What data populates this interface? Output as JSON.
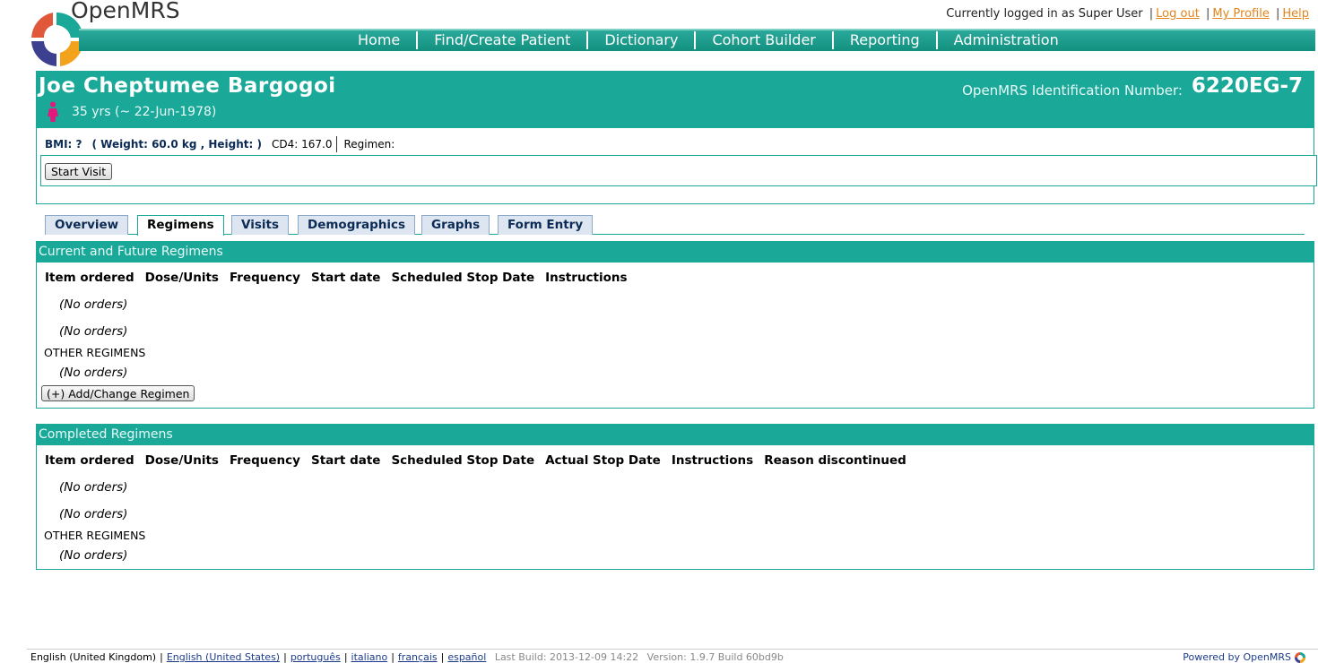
{
  "brand": {
    "name": "OpenMRS"
  },
  "user_bar": {
    "logged_in_text": "Currently logged in as Super User",
    "logout": "Log out",
    "my_profile": "My Profile",
    "help": "Help"
  },
  "nav": {
    "items": [
      "Home",
      "Find/Create Patient",
      "Dictionary",
      "Cohort Builder",
      "Reporting",
      "Administration"
    ]
  },
  "patient": {
    "name": "Joe Cheptumee Bargogoi",
    "age": "35 yrs (~ 22-Jun-1978)",
    "gender_icon": "female-icon",
    "id_label": "OpenMRS Identification Number:",
    "id_value": "6220EG-7",
    "bmi": "BMI: ?",
    "weight_height": "( Weight: 60.0 kg , Height: )",
    "cd4_label": "CD4:",
    "cd4_value": "167.0",
    "regimen_label": "Regimen:",
    "start_visit": "Start Visit"
  },
  "tabs": {
    "active": "Regimens",
    "items": [
      "Overview",
      "Regimens",
      "Visits",
      "Demographics",
      "Graphs",
      "Form Entry"
    ]
  },
  "current_regimens": {
    "title": "Current and Future Regimens",
    "headers": [
      "Item ordered",
      "Dose/Units",
      "Frequency",
      "Start date",
      "Scheduled Stop Date",
      "Instructions"
    ],
    "no_orders_1": "(No orders)",
    "no_orders_2": "(No orders)",
    "other_regimens": "OTHER REGIMENS",
    "no_orders_3": "(No orders)",
    "add_button": "(+) Add/Change Regimen"
  },
  "completed_regimens": {
    "title": "Completed Regimens",
    "headers": [
      "Item ordered",
      "Dose/Units",
      "Frequency",
      "Start date",
      "Scheduled Stop Date",
      "Actual Stop Date",
      "Instructions",
      "Reason discontinued"
    ],
    "no_orders_1": "(No orders)",
    "no_orders_2": "(No orders)",
    "other_regimens": "OTHER REGIMENS",
    "no_orders_3": "(No orders)"
  },
  "footer": {
    "current_locale": "English (United Kingdom)",
    "locales": [
      "English (United States)",
      "português",
      "italiano",
      "français",
      "español"
    ],
    "last_build": "Last Build: 2013-12-09 14:22",
    "version": "Version: 1.9.7 Build 60bd9b",
    "powered_by": "Powered by OpenMRS"
  },
  "colors": {
    "teal": "#1aa899",
    "link_orange": "#e3851c",
    "tab_blue": "#0b2a55"
  }
}
